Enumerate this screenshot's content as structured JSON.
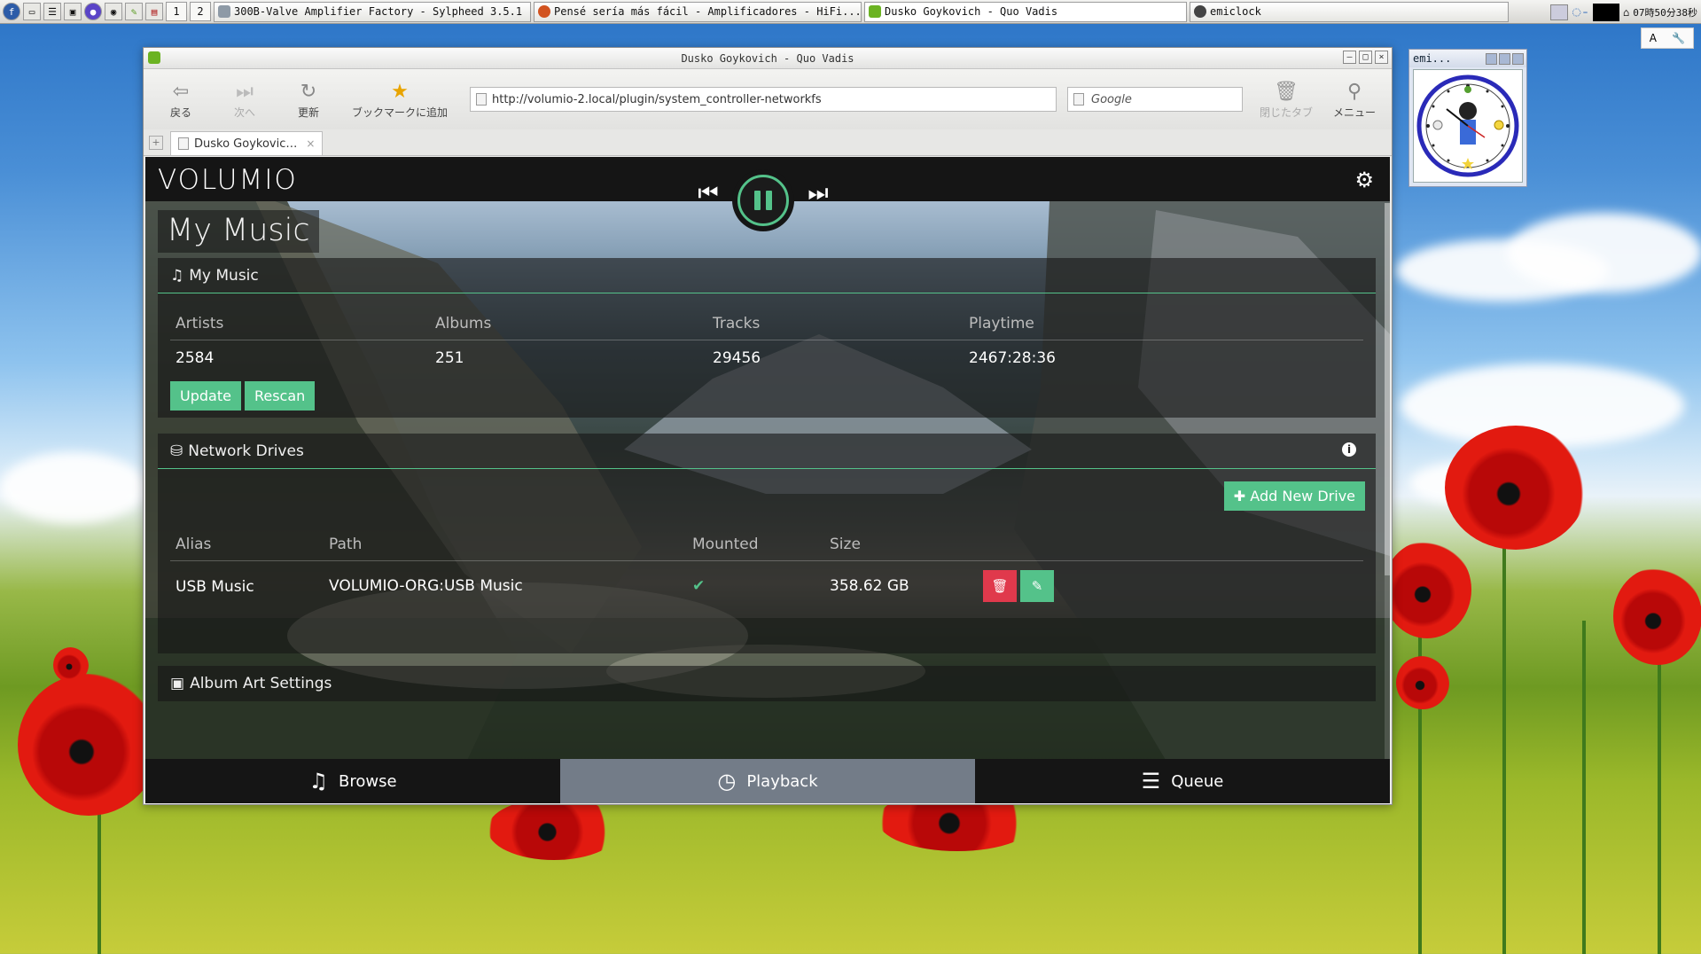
{
  "taskbar": {
    "workspaces": [
      "1",
      "2"
    ],
    "tasks": [
      {
        "label": "300B-Valve Amplifier Factory - Sylpheed 3.5.1"
      },
      {
        "label": "Pensé sería más fácil - Amplificadores - HiFi..."
      },
      {
        "label": "Dusko Goykovich - Quo Vadis"
      },
      {
        "label": "emiclock"
      }
    ],
    "clock": "07時50分38秒",
    "input_mode": "A"
  },
  "browser": {
    "window_title": "Dusko Goykovich - Quo Vadis",
    "toolbar": {
      "back": "戻る",
      "forward": "次へ",
      "reload": "更新",
      "bookmark": "ブックマークに追加",
      "closed_tabs": "閉じたタブ",
      "menu": "メニュー"
    },
    "url": "http://volumio-2.local/plugin/system_controller-networkfs",
    "search_placeholder": "Google",
    "tab_title": "Dusko Goykovic…"
  },
  "volumio": {
    "logo": "VOLUMIO",
    "page_title": "My Music",
    "my_music": {
      "heading": "My Music",
      "columns": [
        "Artists",
        "Albums",
        "Tracks",
        "Playtime"
      ],
      "values": [
        "2584",
        "251",
        "29456",
        "2467:28:36"
      ],
      "update_label": "Update",
      "rescan_label": "Rescan"
    },
    "network_drives": {
      "heading": "Network Drives",
      "add_label": "Add New Drive",
      "columns": [
        "Alias",
        "Path",
        "Mounted",
        "Size"
      ],
      "rows": [
        {
          "alias": "USB Music",
          "path": "VOLUMIO-ORG:USB Music",
          "mounted": "✔",
          "size": "358.62 GB"
        }
      ]
    },
    "album_art": {
      "heading": "Album Art Settings"
    },
    "footer": {
      "browse": "Browse",
      "playback": "Playback",
      "queue": "Queue"
    },
    "accent_color": "#54c28a",
    "delete_color": "#e0394c"
  },
  "clock_widget": {
    "title": "emi..."
  }
}
